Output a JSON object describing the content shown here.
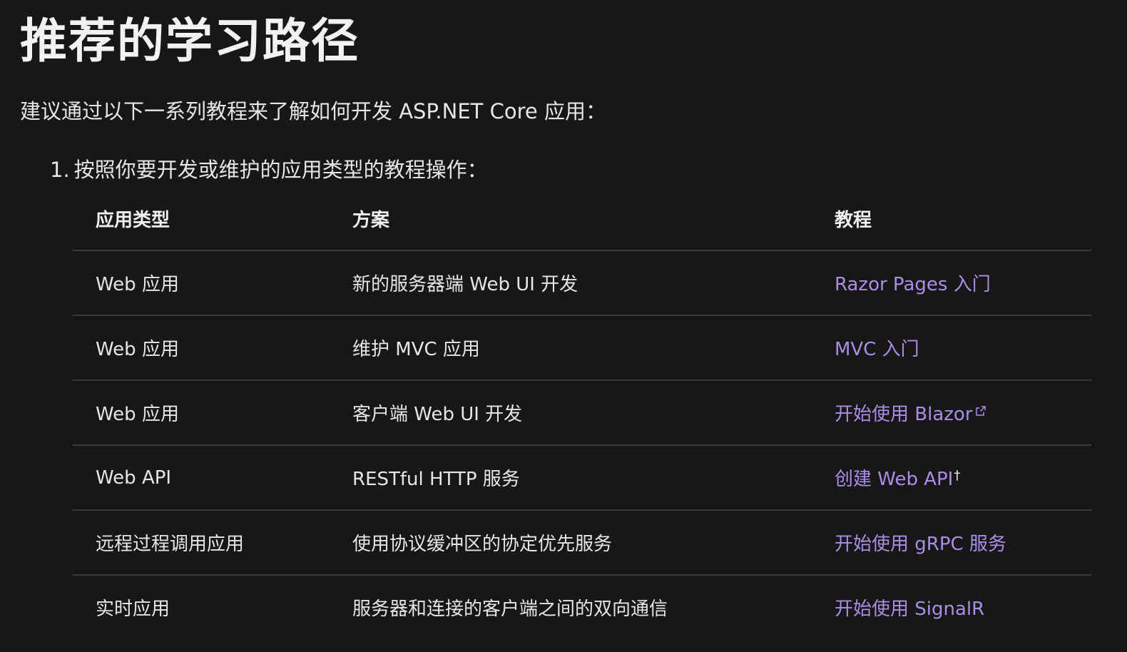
{
  "heading": "推荐的学习路径",
  "intro": "建议通过以下一系列教程来了解如何开发 ASP.NET Core 应用：",
  "step": {
    "number": "1.",
    "text": "按照你要开发或维护的应用类型的教程操作："
  },
  "table": {
    "headers": [
      "应用类型",
      "方案",
      "教程"
    ],
    "rows": [
      {
        "app_type": "Web 应用",
        "scenario": "新的服务器端 Web UI 开发",
        "tutorial": "Razor Pages 入门"
      },
      {
        "app_type": "Web 应用",
        "scenario": "维护 MVC 应用",
        "tutorial": "MVC 入门"
      },
      {
        "app_type": "Web 应用",
        "scenario": "客户端 Web UI 开发",
        "tutorial": "开始使用 Blazor",
        "external_icon": "external-link-icon"
      },
      {
        "app_type": "Web API",
        "scenario": "RESTful HTTP 服务",
        "tutorial": "创建 Web API",
        "footnote": "†"
      },
      {
        "app_type": "远程过程调用应用",
        "scenario": "使用协议缓冲区的协定优先服务",
        "tutorial": "开始使用 gRPC 服务"
      },
      {
        "app_type": "实时应用",
        "scenario": "服务器和连接的客户端之间的双向通信",
        "tutorial": "开始使用 SignalR"
      }
    ]
  },
  "colors": {
    "background": "#171717",
    "text": "#e6e6e6",
    "link": "#a98ee6",
    "divider": "#3a3a3a"
  }
}
